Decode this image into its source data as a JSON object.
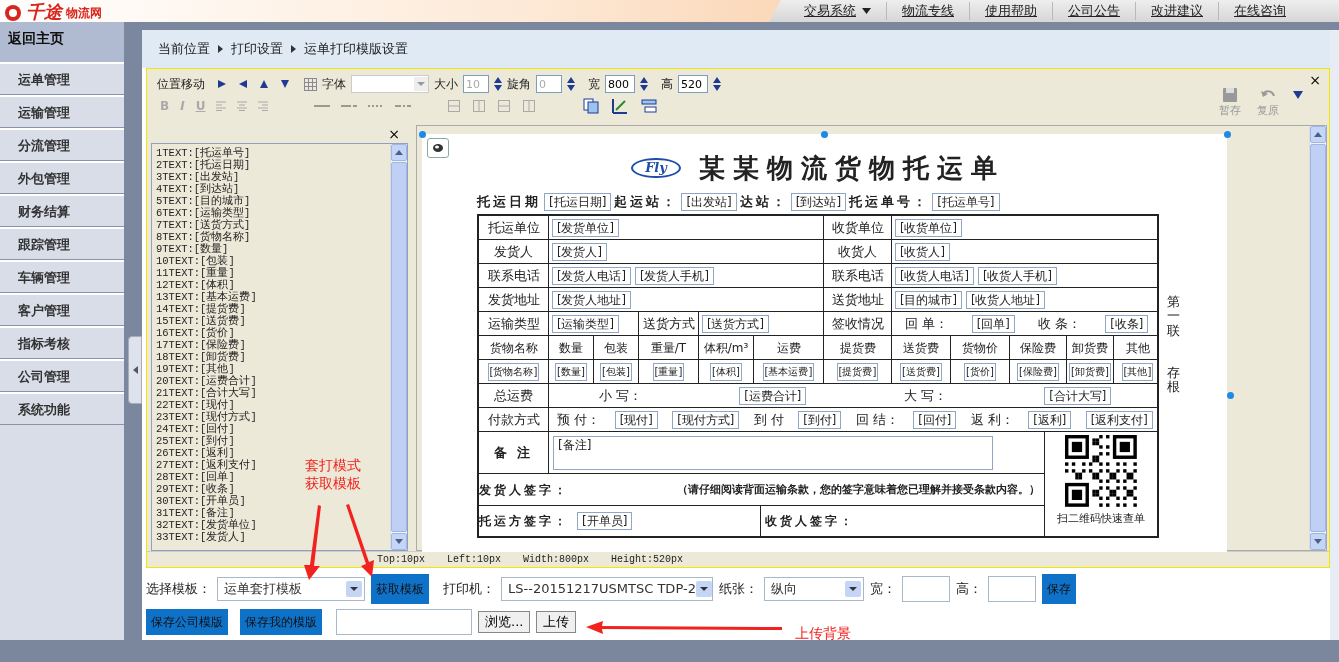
{
  "header": {
    "logo": {
      "main": "千途",
      "sub": "物流网"
    },
    "nav": [
      {
        "label": "交易系统",
        "dropdown": true
      },
      {
        "label": "物流专线",
        "dropdown": false
      },
      {
        "label": "使用帮助",
        "dropdown": false
      },
      {
        "label": "公司公告",
        "dropdown": false
      },
      {
        "label": "改进建议",
        "dropdown": false
      },
      {
        "label": "在线咨询",
        "dropdown": false
      }
    ]
  },
  "sidebar": {
    "home": "返回主页",
    "items": [
      "运单管理",
      "运输管理",
      "分流管理",
      "外包管理",
      "财务结算",
      "跟踪管理",
      "车辆管理",
      "客户管理",
      "指标考核",
      "公司管理",
      "系统功能"
    ]
  },
  "breadcrumb": [
    "当前位置",
    "打印设置",
    "运单打印模版设置"
  ],
  "toolbar": {
    "move_label": "位置移动",
    "font_label": "字体",
    "close": "×",
    "spinners": [
      {
        "label": "大小",
        "value": "10",
        "disabled": true
      },
      {
        "label": "旋角",
        "value": "0",
        "disabled": true
      },
      {
        "label": "宽",
        "value": "800",
        "disabled": false
      },
      {
        "label": "高",
        "value": "520",
        "disabled": false
      }
    ],
    "format_buttons": [
      {
        "label": "B",
        "disabled": true
      },
      {
        "label": "I",
        "disabled": true
      },
      {
        "label": "U",
        "disabled": true
      }
    ],
    "actions": [
      {
        "label": "暂存",
        "disabled": true
      },
      {
        "label": "复原",
        "disabled": true
      }
    ]
  },
  "field_panel": {
    "close": "×",
    "items": [
      "1TEXT:[托运单号]",
      "2TEXT:[托运日期]",
      "3TEXT:[出发站]",
      "4TEXT:[到达站]",
      "5TEXT:[目的城市]",
      "6TEXT:[运输类型]",
      "7TEXT:[送货方式]",
      "8TEXT:[货物名称]",
      "9TEXT:[数量]",
      "10TEXT:[包装]",
      "11TEXT:[重量]",
      "12TEXT:[体积]",
      "13TEXT:[基本运费]",
      "14TEXT:[提货费]",
      "15TEXT:[送货费]",
      "16TEXT:[货价]",
      "17TEXT:[保险费]",
      "18TEXT:[卸货费]",
      "19TEXT:[其他]",
      "20TEXT:[运费合计]",
      "21TEXT:[合计大写]",
      "22TEXT:[现付]",
      "23TEXT:[现付方式]",
      "24TEXT:[回付]",
      "25TEXT:[到付]",
      "26TEXT:[返利]",
      "27TEXT:[返利支付]",
      "28TEXT:[回单]",
      "29TEXT:[收条]",
      "30TEXT:[开单员]",
      "31TEXT:[备注]",
      "32TEXT:[发货单位]",
      "33TEXT:[发货人]"
    ]
  },
  "waybill": {
    "logo_text": "Fly",
    "title": "某某物流货物托运单",
    "head": [
      {
        "kind": "label",
        "text": "托运日期"
      },
      {
        "kind": "field",
        "text": "[托运日期]"
      },
      {
        "kind": "label",
        "text": "起运站："
      },
      {
        "kind": "field",
        "text": "[出发站]"
      },
      {
        "kind": "label",
        "text": "达站："
      },
      {
        "kind": "field",
        "text": "[到达站]"
      },
      {
        "kind": "label",
        "text": "托运单号："
      },
      {
        "kind": "field",
        "text": "[托运单号]"
      }
    ],
    "parties": [
      {
        "left_label": "托运单位",
        "left_fields": [
          "[发货单位]"
        ],
        "right_label": "收货单位",
        "right_fields": [
          "[收货单位]"
        ]
      },
      {
        "left_label": "发货人",
        "left_fields": [
          "[发货人]"
        ],
        "right_label": "收货人",
        "right_fields": [
          "[收货人]"
        ]
      },
      {
        "left_label": "联系电话",
        "left_fields": [
          "[发货人电话]",
          "[发货人手机]"
        ],
        "right_label": "联系电话",
        "right_fields": [
          "[收货人电话]",
          "[收货人手机]"
        ]
      },
      {
        "left_label": "发货地址",
        "left_fields": [
          "[发货人地址]"
        ],
        "right_label": "送货地址",
        "right_fields": [
          "[目的城市]",
          "[收货人地址]"
        ]
      }
    ],
    "receipt_row": {
      "transport_label": "运输类型",
      "transport_field": "[运输类型]",
      "delivery_label": "送货方式",
      "delivery_field": "[送货方式]",
      "sign_label": "签收情况",
      "sign_parts": [
        {
          "kind": "label",
          "text": "回 单："
        },
        {
          "kind": "field",
          "text": "[回单]"
        },
        {
          "kind": "label",
          "text": "收 条："
        },
        {
          "kind": "field",
          "text": "[收条]"
        }
      ]
    },
    "goods": {
      "headers": [
        "货物名称",
        "数量",
        "包装",
        "重量/T",
        "体积/m³",
        "运费",
        "提货费",
        "送货费",
        "货物价",
        "保险费",
        "卸货费",
        "其他"
      ],
      "fields": [
        "[货物名称]",
        "[数量]",
        "[包装]",
        "[重量]",
        "[体积]",
        "[基本运费]",
        "[提货费]",
        "[送货费]",
        "[货价]",
        "[保险费]",
        "[卸货费]",
        "[其他]"
      ]
    },
    "totals": {
      "label": "总运费",
      "parts": [
        {
          "kind": "label",
          "text": "小 写："
        },
        {
          "kind": "field",
          "text": "[运费合计]"
        },
        {
          "kind": "label",
          "text": "大 写："
        },
        {
          "kind": "field",
          "text": "[合计大写]"
        }
      ]
    },
    "payment": {
      "label": "付款方式",
      "parts": [
        {
          "kind": "label",
          "text": "预 付："
        },
        {
          "kind": "field",
          "text": "[现付]"
        },
        {
          "kind": "field",
          "text": "[现付方式]"
        },
        {
          "kind": "label",
          "text": "到 付"
        },
        {
          "kind": "field",
          "text": "[到付]"
        },
        {
          "kind": "label",
          "text": "回 结："
        },
        {
          "kind": "field",
          "text": "[回付]"
        },
        {
          "kind": "label",
          "text": "返 利："
        },
        {
          "kind": "field",
          "text": "[返利]"
        },
        {
          "kind": "field",
          "text": "[返利支付]"
        }
      ]
    },
    "remark": {
      "label": "备 注",
      "field": "[备注]"
    },
    "shipper_sign": {
      "label": "发货人签字：",
      "note": "（请仔细阅读背面运输条款，您的签字意味着您已理解并接受条款内容。）"
    },
    "carrier_sign": {
      "label": "托运方签字：",
      "field": "[开单员]",
      "receiver_label": "收货人签字："
    },
    "qr_caption": "扫二维码快速查单",
    "side_labels": [
      "第一联",
      "存根"
    ]
  },
  "status": [
    "Top:10px",
    "Left:10px",
    "Width:800px",
    "Height:520px"
  ],
  "controls": {
    "template": {
      "label": "选择模板：",
      "value": "运单套打模板"
    },
    "fetch": "获取模板",
    "printer": {
      "label": "打印机：",
      "value": "LS--20151217USMTSC TDP-2"
    },
    "paper": {
      "label": "纸张：",
      "value": "纵向"
    },
    "width_label": "宽：",
    "height_label": "高：",
    "save": "保存",
    "template_buttons": [
      "保存公司模版",
      "保存我的模版"
    ],
    "browse": "浏览...",
    "upload": "上传"
  },
  "annotations": [
    {
      "lines": [
        "套打模式",
        "获取模板"
      ]
    },
    {
      "lines": [
        "上传背景"
      ]
    }
  ]
}
